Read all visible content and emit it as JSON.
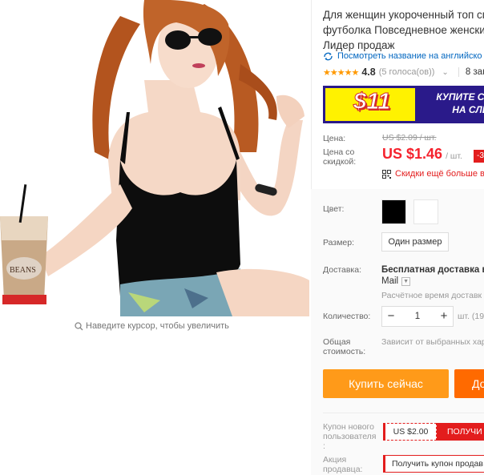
{
  "gallery": {
    "zoom_hint": "Наведите курсор, чтобы увеличить",
    "cup_text": "BEANS"
  },
  "product": {
    "title_line1": "Для женщин укороченный топ сп",
    "title_line2": "футболка Повседневное женский",
    "title_line3": "Лидер продаж",
    "translate_link": "Посмотреть название на английско",
    "rating_value": "4.8",
    "rating_votes": "(5 голоса(ов))",
    "orders": "8 зак",
    "stars": "★★★★★"
  },
  "promo_banner": {
    "amount": "$11",
    "text_line1": "КУПИТЕ СЕЙЧ",
    "text_line2": "НА СЛЕ"
  },
  "price": {
    "label": "Цена:",
    "original": "US $2.09 / шт.",
    "discount_label_line1": "Цена со",
    "discount_label_line2": "скидкой:",
    "current": "US $1.46",
    "unit": "/ шт.",
    "discount_badge": "-3",
    "more_discounts": "Скидки ещё больше в"
  },
  "options": {
    "color_label": "Цвет:",
    "colors": [
      "black",
      "white"
    ],
    "size_label": "Размер:",
    "size_value": "Один размер",
    "shipping_label": "Доставка:",
    "shipping_value": "Бесплатная доставка в R",
    "shipping_method": "Mail",
    "shipping_time": "Расчётное время доставк",
    "quantity_label": "Количество:",
    "quantity_minus": "−",
    "quantity_value": "1",
    "quantity_plus": "+",
    "quantity_unit": "шт. (19",
    "total_label_line1": "Общая",
    "total_label_line2": "стоимость:",
    "total_value": "Зависит от выбранных хар"
  },
  "actions": {
    "buy_now": "Купить сейчас",
    "add_to_cart": "До"
  },
  "coupons": {
    "new_user_label_line1": "Купон нового",
    "new_user_label_line2": "пользователя",
    "new_user_label_line3": ":",
    "new_user_value": "US $2.00",
    "new_user_get": "ПОЛУЧИ",
    "seller_label_line1": "Акция",
    "seller_label_line2": "продавца:",
    "seller_button": "Получить купон продав"
  },
  "colors": {
    "price_red": "#f5222d",
    "buy_orange": "#ff9a19",
    "cart_orange": "#ff6a00",
    "star": "#ff9900",
    "link": "#0066c0",
    "banner_blue": "#2a1a8a",
    "banner_yellow": "#fff200"
  }
}
